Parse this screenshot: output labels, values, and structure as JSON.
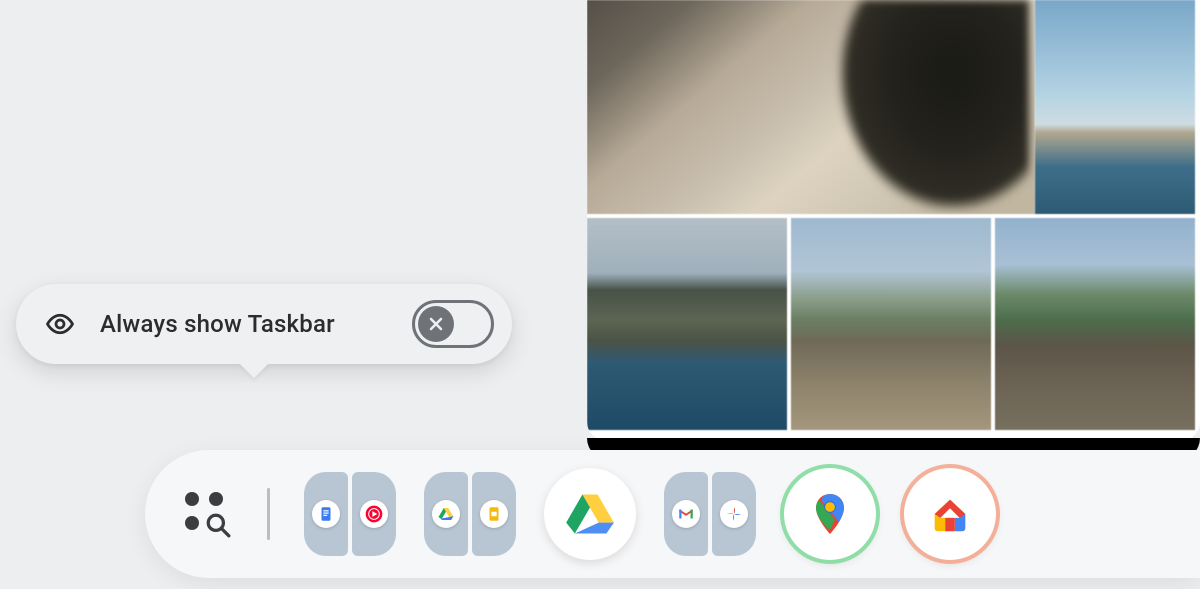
{
  "popup": {
    "label": "Always show Taskbar",
    "toggle_state": "off",
    "icon": "eye-icon",
    "close_icon": "x-icon"
  },
  "taskbar": {
    "launcher_icon": "app-grid-search-icon",
    "items": [
      {
        "type": "pair",
        "left": "google-docs-icon",
        "right": "youtube-music-icon"
      },
      {
        "type": "pair",
        "left": "google-drive-icon",
        "right": "google-slides-icon"
      },
      {
        "type": "app",
        "icon": "google-drive-icon"
      },
      {
        "type": "pair",
        "left": "gmail-icon",
        "right": "google-photos-icon"
      },
      {
        "type": "app",
        "icon": "google-maps-icon",
        "ring": "green"
      },
      {
        "type": "app",
        "icon": "google-home-icon",
        "ring": "peach"
      }
    ]
  },
  "photos_app": {
    "tiles": [
      "dog-on-sand",
      "beach-shoreline",
      "river-cliffs",
      "rural-building-trees",
      "parked-suv-trees"
    ]
  },
  "colors": {
    "popup_bg": "#eef0f2",
    "taskbar_bg": "#f6f7f8",
    "toggle_off": "#6f7377",
    "pair_bg": "#b8c6d3"
  }
}
